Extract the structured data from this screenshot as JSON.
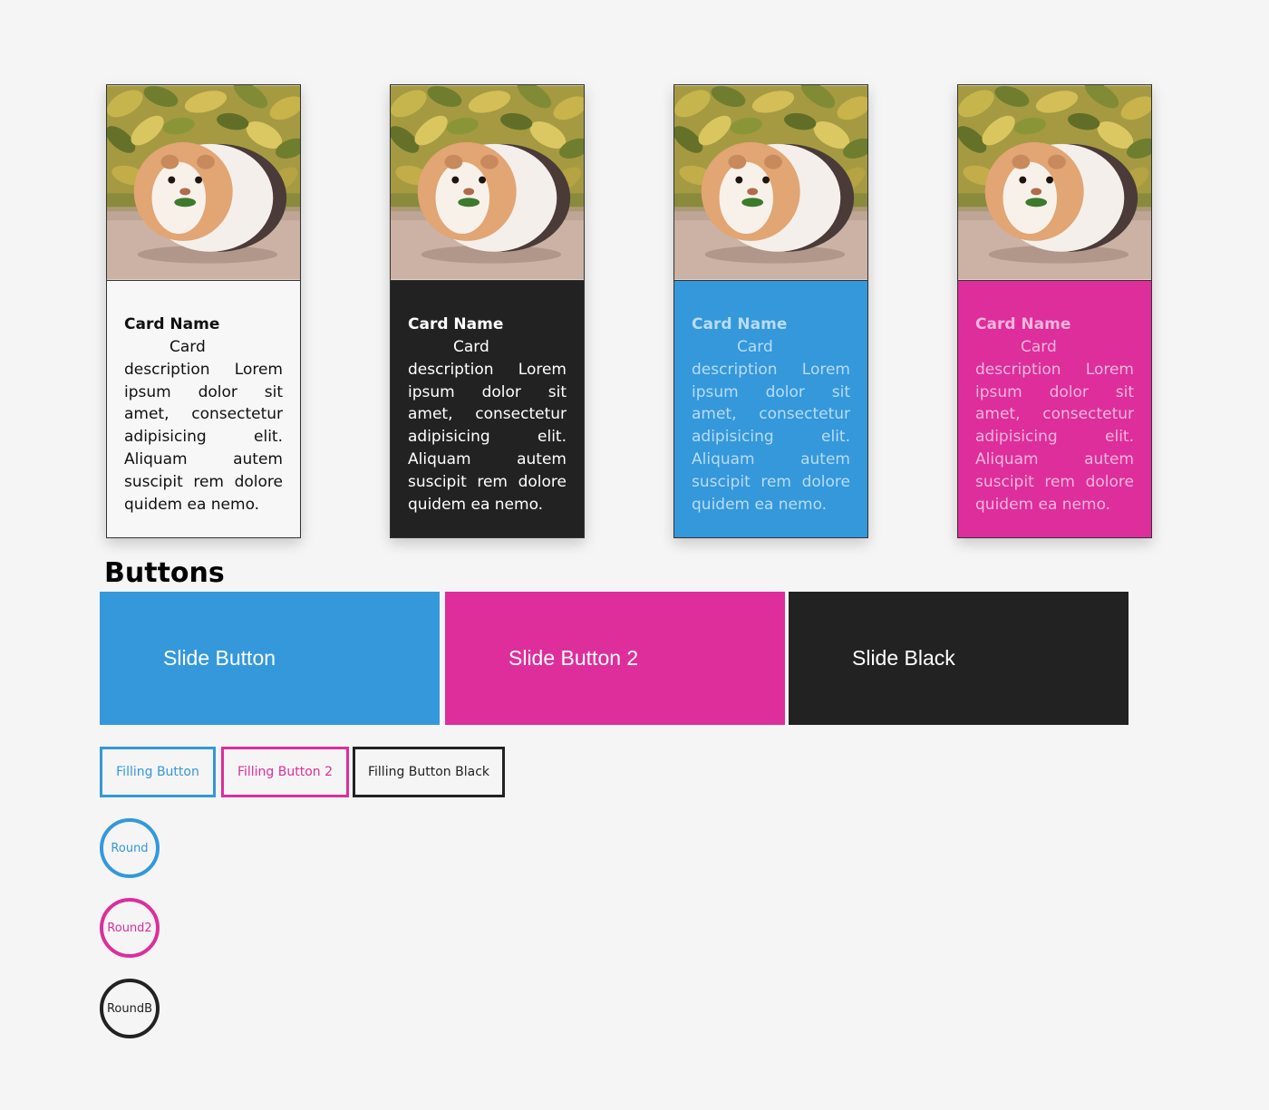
{
  "cards": [
    {
      "theme": "white",
      "image": "guinea-pig-photo",
      "title": "Card Name",
      "description": "Card description Lorem ipsum dolor sit amet, consectetur adipisicing elit. Aliquam autem suscipit rem dolore quidem ea nemo."
    },
    {
      "theme": "black",
      "image": "guinea-pig-photo",
      "title": "Card Name",
      "description": "Card description Lorem ipsum dolor sit amet, consectetur adipisicing elit. Aliquam autem suscipit rem dolore quidem ea nemo."
    },
    {
      "theme": "blue",
      "image": "guinea-pig-photo",
      "title": "Card Name",
      "description": "Card description Lorem ipsum dolor sit amet, consectetur adipisicing elit. Aliquam autem suscipit rem dolore quidem ea nemo."
    },
    {
      "theme": "pink",
      "image": "guinea-pig-photo",
      "title": "Card Name",
      "description": "Card description Lorem ipsum dolor sit amet, consectetur adipisicing elit. Aliquam autem suscipit rem dolore quidem ea nemo."
    }
  ],
  "buttons_section": {
    "title": "Buttons",
    "slide_buttons": [
      "Slide Button",
      "Slide Button 2",
      "Slide Black"
    ],
    "filling_buttons": [
      "Filling Button",
      "Filling Button 2",
      "Filling Button Black"
    ],
    "round_buttons": [
      "Round",
      "Round2",
      "RoundB"
    ]
  },
  "colors": {
    "background": "#f5f5f5",
    "blue": "#3498db",
    "pink": "#dd2e9b",
    "black": "#222222"
  }
}
